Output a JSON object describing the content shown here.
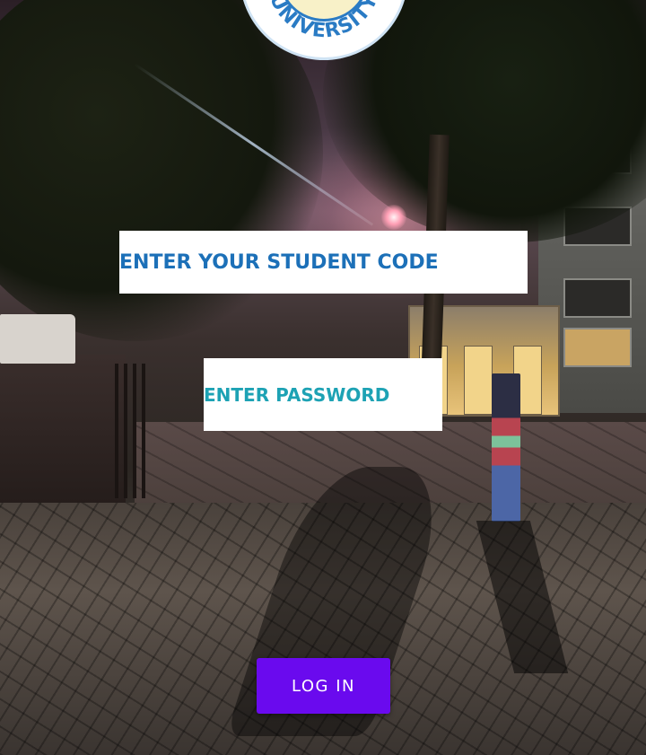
{
  "logo": {
    "text": "UNIVERSITY",
    "ring_color": "#2a7bc4"
  },
  "form": {
    "student_code": {
      "placeholder": "ENTER YOUR STUDENT CODE",
      "value": "",
      "text_color": "#1c70b8"
    },
    "password": {
      "placeholder": "ENTER PASSWORD",
      "value": "",
      "text_color": "#1da2b4"
    },
    "login_button": {
      "label": "LOG IN",
      "color": "#6a0aee"
    }
  }
}
